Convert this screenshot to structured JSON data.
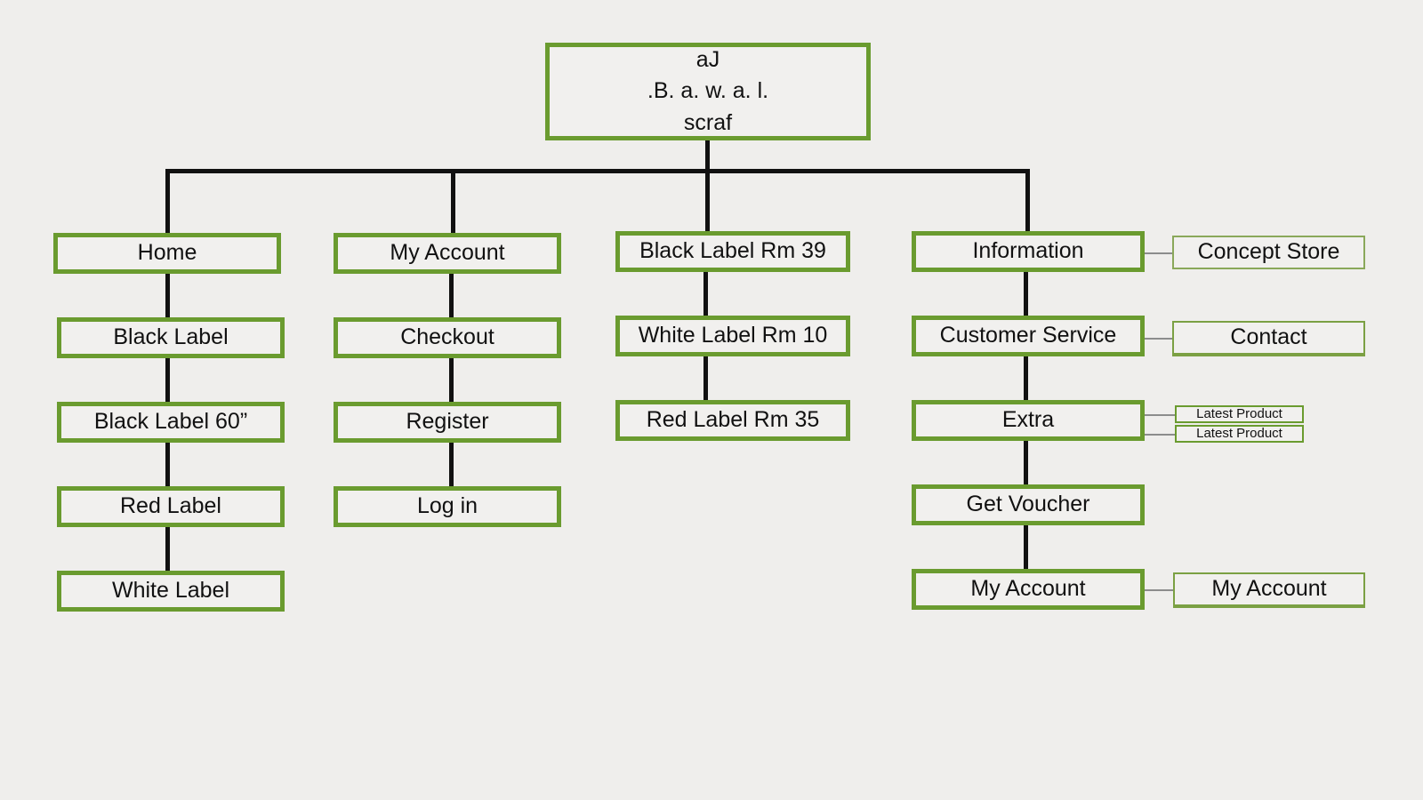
{
  "diagram": {
    "title_lines": [
      "aJ",
      ".B. a. w. a. l.",
      "scraf"
    ],
    "colors": {
      "background": "#efeeec",
      "box_border_green": "#6a9b2f",
      "box_fill": "#f1f0ee",
      "connector_black": "#111111",
      "connector_gray": "#8c8c8c",
      "thin_border_green": "#8aa85a"
    },
    "root": {
      "line1": "aJ",
      "line2": ".B. a. w. a. l.",
      "line3": "scraf"
    },
    "columns": [
      {
        "name": "home",
        "nodes": [
          {
            "label": "Home"
          },
          {
            "label": "Black Label"
          },
          {
            "label": "Black Label 60”"
          },
          {
            "label": "Red Label"
          },
          {
            "label": "White Label"
          }
        ]
      },
      {
        "name": "my-account",
        "nodes": [
          {
            "label": "My Account"
          },
          {
            "label": "Checkout"
          },
          {
            "label": "Register"
          },
          {
            "label": "Log in"
          }
        ]
      },
      {
        "name": "labels-pricing",
        "nodes": [
          {
            "label": "Black Label Rm 39"
          },
          {
            "label": "White Label Rm 10"
          },
          {
            "label": "Red Label Rm 35"
          }
        ]
      },
      {
        "name": "information",
        "nodes": [
          {
            "label": "Information"
          },
          {
            "label": "Customer Service"
          },
          {
            "label": "Extra"
          },
          {
            "label": "Get Voucher"
          },
          {
            "label": "My Account"
          }
        ]
      }
    ],
    "leaves": [
      {
        "name": "concept-store",
        "label": "Concept Store"
      },
      {
        "name": "contact",
        "label": "Contact"
      },
      {
        "name": "latest-product-1",
        "label": "Latest Product"
      },
      {
        "name": "latest-product-2",
        "label": "Latest Product"
      },
      {
        "name": "my-account-leaf",
        "label": "My Account"
      }
    ]
  }
}
